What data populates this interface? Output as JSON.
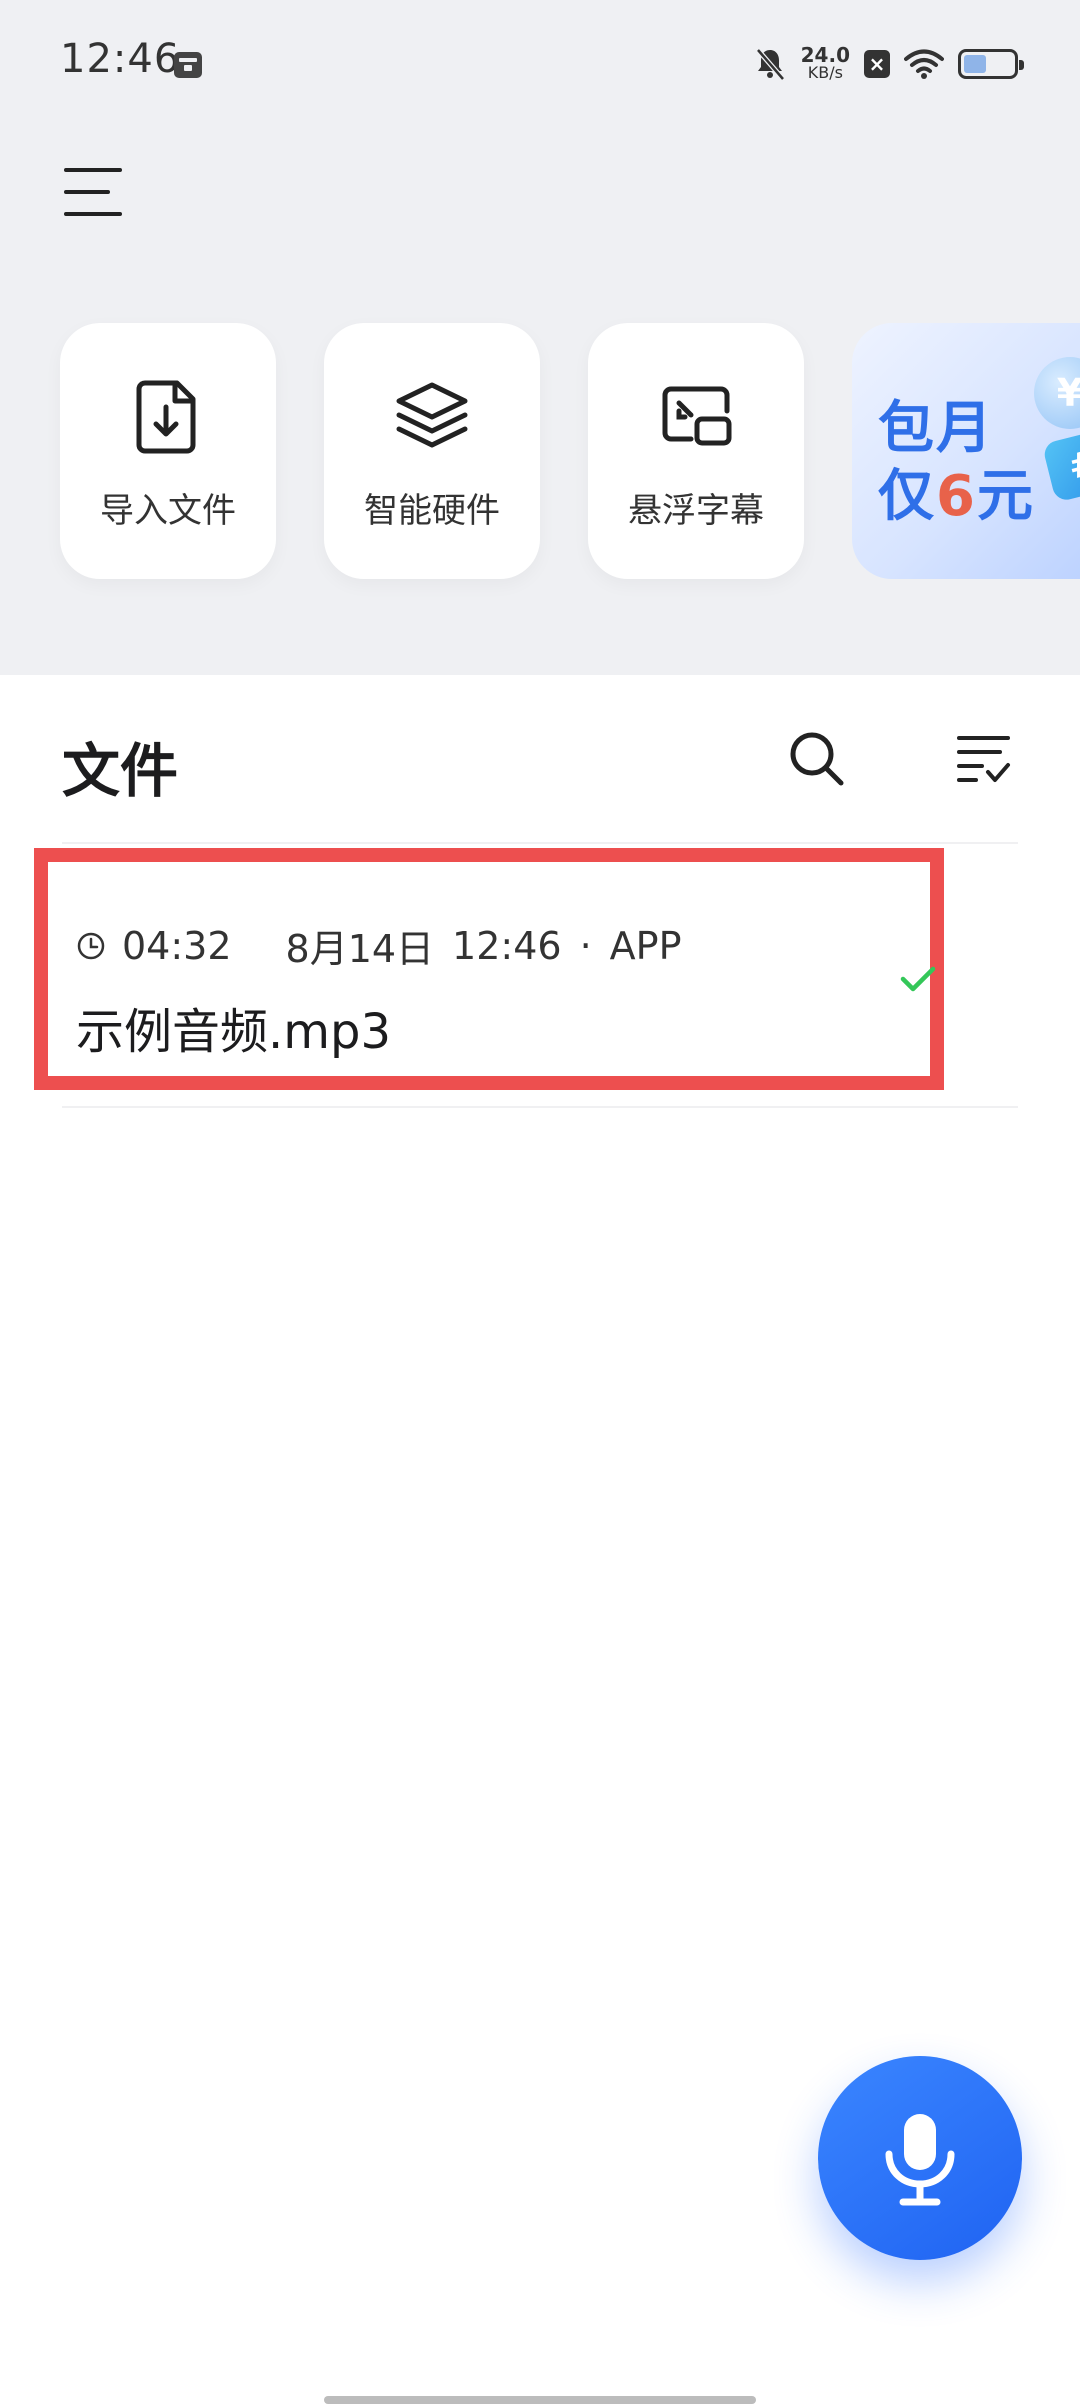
{
  "status_bar": {
    "time": "12:46",
    "net_speed_value": "24.0",
    "net_speed_unit": "KB/s",
    "battery_level_fraction": 0.45
  },
  "quick_actions": [
    {
      "label": "导入文件",
      "icon": "import-file-icon"
    },
    {
      "label": "智能硬件",
      "icon": "layers-icon"
    },
    {
      "label": "悬浮字幕",
      "icon": "floating-caption-icon"
    }
  ],
  "promo": {
    "line1": "包月",
    "line2_prefix": "仅",
    "line2_highlight": "6",
    "line2_suffix": "元",
    "coin_symbol": "¥",
    "chip_symbol": "#"
  },
  "files": {
    "title": "文件",
    "items": [
      {
        "duration": "04:32",
        "date": "8月14日",
        "time": "12:46",
        "separator": "·",
        "source": "APP",
        "name": "示例音频.mp3"
      }
    ]
  },
  "colors": {
    "accent": "#2f6fe8",
    "highlight_border": "#ed4f4f",
    "check_green": "#34c759",
    "promo_highlight": "#e8624a"
  }
}
